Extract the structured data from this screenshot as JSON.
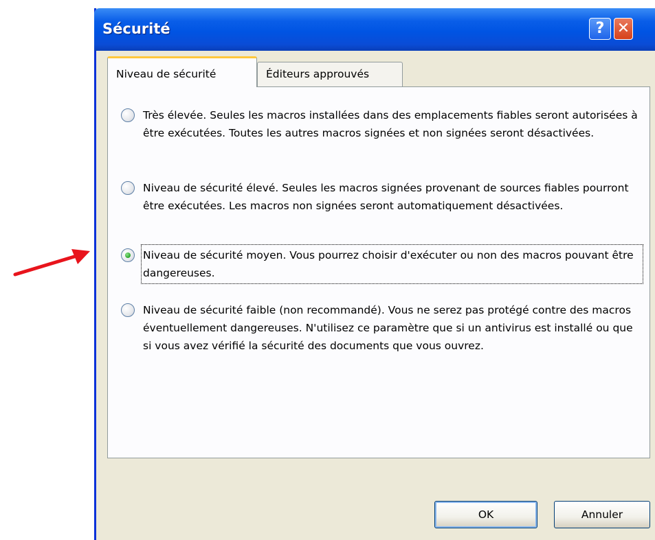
{
  "window": {
    "title": "Sécurité",
    "help_icon": "question-mark",
    "close_icon": "x"
  },
  "tabs": [
    {
      "label": "Niveau de sécurité",
      "active": true
    },
    {
      "label": "Éditeurs approuvés",
      "active": false
    }
  ],
  "options": [
    {
      "text": "Très élevée. Seules les macros installées dans des emplacements fiables seront autorisées à être exécutées. Toutes les autres macros signées et non signées seront désactivées.",
      "selected": false
    },
    {
      "text": "Niveau de sécurité élevé. Seules les macros signées provenant de sources fiables pourront être exécutées. Les macros non signées seront automatiquement désactivées.",
      "selected": false
    },
    {
      "text": "Niveau de sécurité moyen. Vous pourrez choisir d'exécuter ou non des macros pouvant être dangereuses.",
      "selected": true
    },
    {
      "text": "Niveau de sécurité faible (non recommandé). Vous ne serez pas protégé contre des macros éventuellement dangereuses. N'utilisez ce paramètre que si un antivirus est installé ou que si vous avez vérifié la sécurité des documents que vous ouvrez.",
      "selected": false
    }
  ],
  "buttons": {
    "ok": "OK",
    "cancel": "Annuler"
  },
  "colors": {
    "titlebar": "#0054e3",
    "dialog_bg": "#ece9d8",
    "arrow": "#e8141c",
    "radio_selected": "#2aa52a"
  }
}
